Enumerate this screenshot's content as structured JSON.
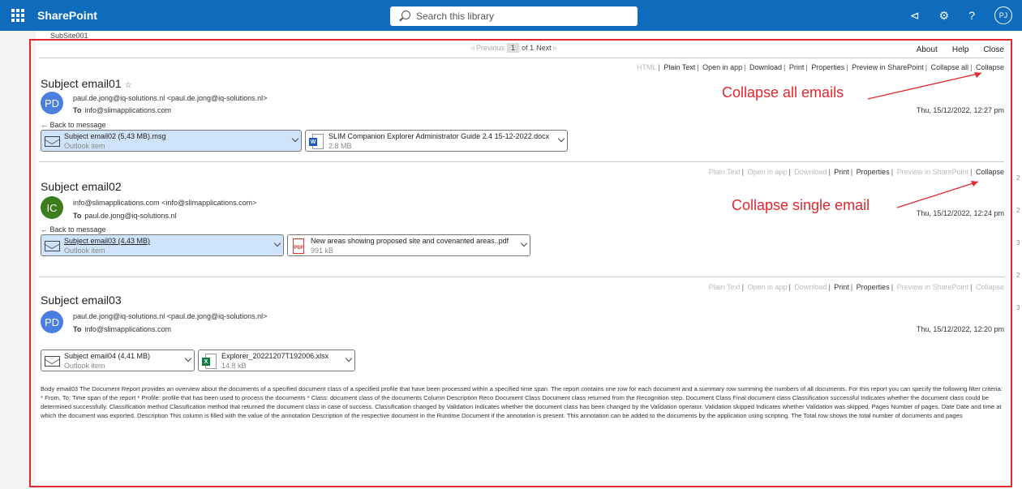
{
  "app": {
    "name": "SharePoint",
    "search_placeholder": "Search this library",
    "user_initials": "PJ"
  },
  "icons": {
    "top": [
      "megaphone-icon",
      "gear-icon",
      "help-icon"
    ]
  },
  "breadcrumb": {
    "subsite": "SubSite001"
  },
  "pager": {
    "previous": "Previous",
    "current": "1",
    "of": "of 1",
    "next": "Next"
  },
  "header_links": {
    "about": "About",
    "help": "Help",
    "close": "Close"
  },
  "emails": [
    {
      "subject": "Subject email01",
      "initials": "PD",
      "avatar_color": "#4a7fe0",
      "from": "paul.de.jong@iq-solutions.nl <paul.de.jong@iq-solutions.nl>",
      "to_label": "To",
      "to": "info@slimapplications.com",
      "date": "Thu, 15/12/2022, 12:27 pm",
      "back": "Back to message",
      "actions": [
        "HTML",
        "Plain Text",
        "Open in app",
        "Download",
        "Print",
        "Properties",
        "Preview in SharePoint",
        "Collapse all",
        "Collapse"
      ],
      "attachments": [
        {
          "name": "Subject email02 (5,43 MB).msg",
          "sub": "Outlook item"
        },
        {
          "name": "SLIM Companion Explorer Administrator Guide 2.4 15-12-2022.docx",
          "sub": "2.8 MB"
        }
      ]
    },
    {
      "subject": "Subject email02",
      "initials": "IC",
      "avatar_color": "#3c7d1e",
      "from": "info@slimapplications.com <info@slimapplications.com>",
      "to_label": "To",
      "to": "paul.de.jong@iq-solutions.nl",
      "date": "Thu, 15/12/2022, 12:24 pm",
      "back": "Back to message",
      "actions": [
        "Plain Text",
        "Open in app",
        "Download",
        "Print",
        "Properties",
        "Preview in SharePoint",
        "Collapse"
      ],
      "attachments": [
        {
          "name": "Subject email03 (4,43 MB)",
          "sub": "Outlook item"
        },
        {
          "name": "New areas showing proposed site and covenanted areas..pdf",
          "sub": "991 kB"
        }
      ]
    },
    {
      "subject": "Subject email03",
      "initials": "PD",
      "avatar_color": "#4a7fe0",
      "from": "paul.de.jong@iq-solutions.nl <paul.de.jong@iq-solutions.nl>",
      "to_label": "To",
      "to": "info@slimapplications.com",
      "date": "Thu, 15/12/2022, 12:20 pm",
      "actions": [
        "Plain Text",
        "Open in app",
        "Download",
        "Print",
        "Properties",
        "Preview in SharePoint",
        "Collapse"
      ],
      "attachments": [
        {
          "name": "Subject email04 (4,41 MB)",
          "sub": "Outlook item"
        },
        {
          "name": "Explorer_20221207T192006.xlsx",
          "sub": "14.8 kB"
        }
      ],
      "body": "Body email03 The Document Report provides an overview about the documents of a specified document class of a specified profile that have been processed within a specified time span. The report contains one row for each document and a summary row summing the numbers of all documents. For this report you can specify the following filter criteria: * From, To: Time span of the report * Profile: profile that has been used to process the documents * Class: document class of the documents Column Description Reco Document Class Document class returned from the Recognition step. Document Class Final document class Classification successful Indicates whether the document class could be determined successfully. Classification method Classification method that returned the document class in case of success. Classification changed by Validation Indicates whether the document class has been changed by the Validation operator. Validation skipped Indicates whether Validation was skipped. Pages Number of pages. Date Date and time at which the document was exported. Description This column is filled with the value of the annotation Description of the respective document in the Runtime Document if the annotation is present. This annotation can be added to the documents by the application using scripting. The Total row shows the total number of documents and pages"
    }
  ],
  "annotations": {
    "collapse_all": "Collapse all emails",
    "collapse_single": "Collapse single email",
    "color": "#e0282e"
  },
  "side_numbers": [
    "2",
    "2",
    "3",
    "2",
    "3"
  ]
}
